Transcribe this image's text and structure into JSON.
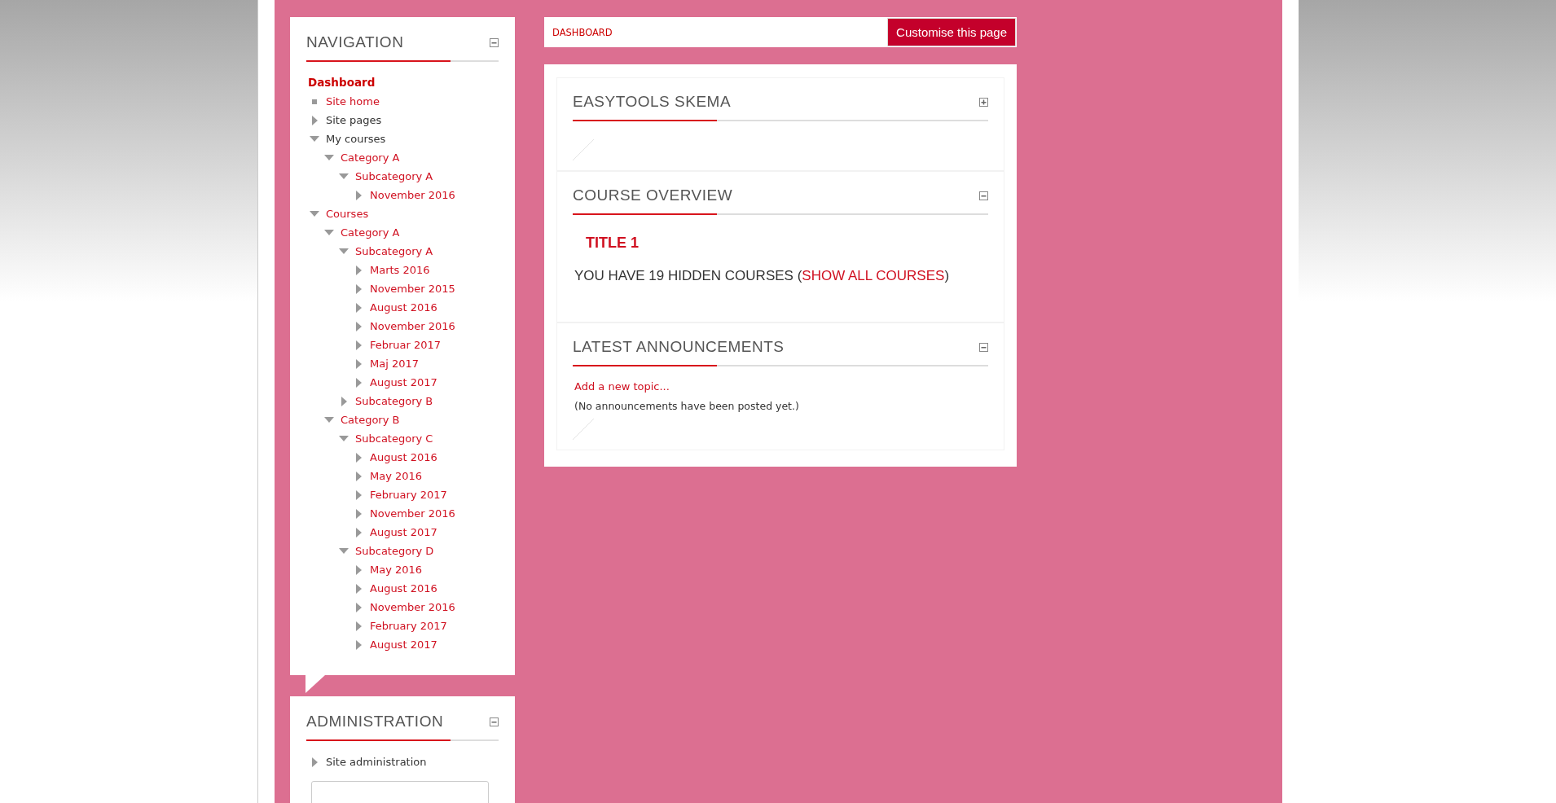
{
  "navigation": {
    "title": "NAVIGATION",
    "collapsed": false,
    "dashboard": "Dashboard",
    "items": [
      {
        "label": "Site home",
        "kind": "leaf",
        "link": true
      },
      {
        "label": "Site pages",
        "kind": "branch",
        "expanded": false,
        "link": false
      },
      {
        "label": "My courses",
        "kind": "branch",
        "expanded": true,
        "link": false,
        "children": [
          {
            "label": "Category A",
            "kind": "branch",
            "expanded": true,
            "link": true,
            "children": [
              {
                "label": "Subcategory A",
                "kind": "branch",
                "expanded": true,
                "link": true,
                "children": [
                  {
                    "label": "November 2016",
                    "kind": "branch",
                    "expanded": false,
                    "link": true
                  }
                ]
              }
            ]
          }
        ]
      },
      {
        "label": "Courses",
        "kind": "branch",
        "expanded": true,
        "link": true,
        "children": [
          {
            "label": "Category A",
            "kind": "branch",
            "expanded": true,
            "link": true,
            "children": [
              {
                "label": "Subcategory A",
                "kind": "branch",
                "expanded": true,
                "link": true,
                "children": [
                  {
                    "label": "Marts 2016",
                    "kind": "branch",
                    "expanded": false,
                    "link": true
                  },
                  {
                    "label": "November 2015",
                    "kind": "branch",
                    "expanded": false,
                    "link": true
                  },
                  {
                    "label": "August 2016",
                    "kind": "branch",
                    "expanded": false,
                    "link": true
                  },
                  {
                    "label": "November 2016",
                    "kind": "branch",
                    "expanded": false,
                    "link": true
                  },
                  {
                    "label": "Februar 2017",
                    "kind": "branch",
                    "expanded": false,
                    "link": true
                  },
                  {
                    "label": "Maj 2017",
                    "kind": "branch",
                    "expanded": false,
                    "link": true
                  },
                  {
                    "label": "August 2017",
                    "kind": "branch",
                    "expanded": false,
                    "link": true
                  }
                ]
              },
              {
                "label": "Subcategory B",
                "kind": "branch",
                "expanded": false,
                "link": true
              }
            ]
          },
          {
            "label": "Category B",
            "kind": "branch",
            "expanded": true,
            "link": true,
            "children": [
              {
                "label": "Subcategory C",
                "kind": "branch",
                "expanded": true,
                "link": true,
                "children": [
                  {
                    "label": "August 2016",
                    "kind": "branch",
                    "expanded": false,
                    "link": true
                  },
                  {
                    "label": "May 2016",
                    "kind": "branch",
                    "expanded": false,
                    "link": true
                  },
                  {
                    "label": "February 2017",
                    "kind": "branch",
                    "expanded": false,
                    "link": true
                  },
                  {
                    "label": "November 2016",
                    "kind": "branch",
                    "expanded": false,
                    "link": true
                  },
                  {
                    "label": "August 2017",
                    "kind": "branch",
                    "expanded": false,
                    "link": true
                  }
                ]
              },
              {
                "label": "Subcategory D",
                "kind": "branch",
                "expanded": true,
                "link": true,
                "children": [
                  {
                    "label": "May 2016",
                    "kind": "branch",
                    "expanded": false,
                    "link": true
                  },
                  {
                    "label": "August 2016",
                    "kind": "branch",
                    "expanded": false,
                    "link": true
                  },
                  {
                    "label": "November 2016",
                    "kind": "branch",
                    "expanded": false,
                    "link": true
                  },
                  {
                    "label": "February 2017",
                    "kind": "branch",
                    "expanded": false,
                    "link": true
                  },
                  {
                    "label": "August 2017",
                    "kind": "branch",
                    "expanded": false,
                    "link": true
                  }
                ]
              }
            ]
          }
        ]
      }
    ]
  },
  "administration": {
    "title": "ADMINISTRATION",
    "collapsed": false,
    "items": [
      {
        "label": "Site administration",
        "kind": "branch",
        "expanded": false,
        "link": false
      }
    ]
  },
  "breadcrumb": "DASHBOARD",
  "customise_button": "Customise this page",
  "blocks": [
    {
      "kind": "empty",
      "title": "EASYTOOLS SKEMA",
      "collapsed": true
    },
    {
      "kind": "courses",
      "title": "COURSE OVERVIEW",
      "collapsed": false,
      "course_title": "TITLE 1",
      "hidden_text": "YOU HAVE 19 HIDDEN COURSES (",
      "hidden_link": "SHOW ALL COURSES",
      "hidden_end": ")"
    },
    {
      "kind": "news",
      "title": "LATEST ANNOUNCEMENTS",
      "collapsed": false,
      "add_link": "Add a new topic...",
      "message": "(No announcements have been posted yet.)"
    }
  ]
}
